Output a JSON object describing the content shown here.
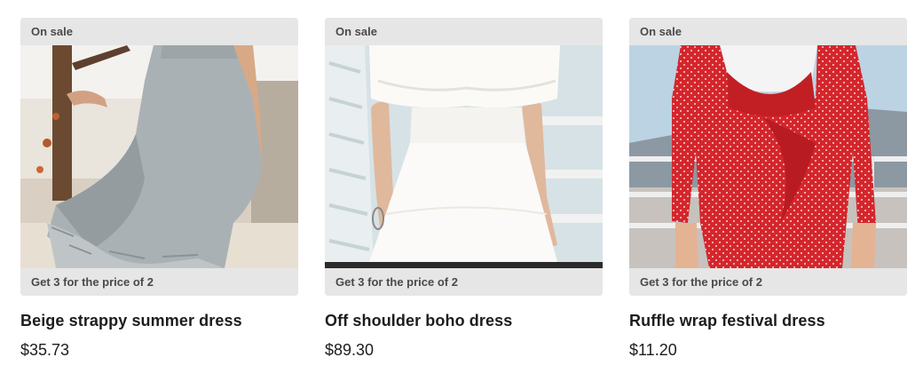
{
  "products": [
    {
      "badge": "On sale",
      "promo": "Get 3 for the price of 2",
      "name": "Beige strappy summer dress",
      "price": "$35.73",
      "image": "woman-in-grey-ruffle-dress-photo"
    },
    {
      "badge": "On sale",
      "promo": "Get 3 for the price of 2",
      "name": "Off shoulder boho dress",
      "price": "$89.30",
      "image": "woman-in-white-off-shoulder-dress-photo"
    },
    {
      "badge": "On sale",
      "promo": "Get 3 for the price of 2",
      "name": "Ruffle wrap festival dress",
      "price": "$11.20",
      "image": "woman-in-red-polka-dot-wrap-dress-photo"
    }
  ],
  "colors": {
    "band": "#e6e6e6",
    "band_text": "#4a4a4a",
    "title_text": "#1d1d1f"
  }
}
